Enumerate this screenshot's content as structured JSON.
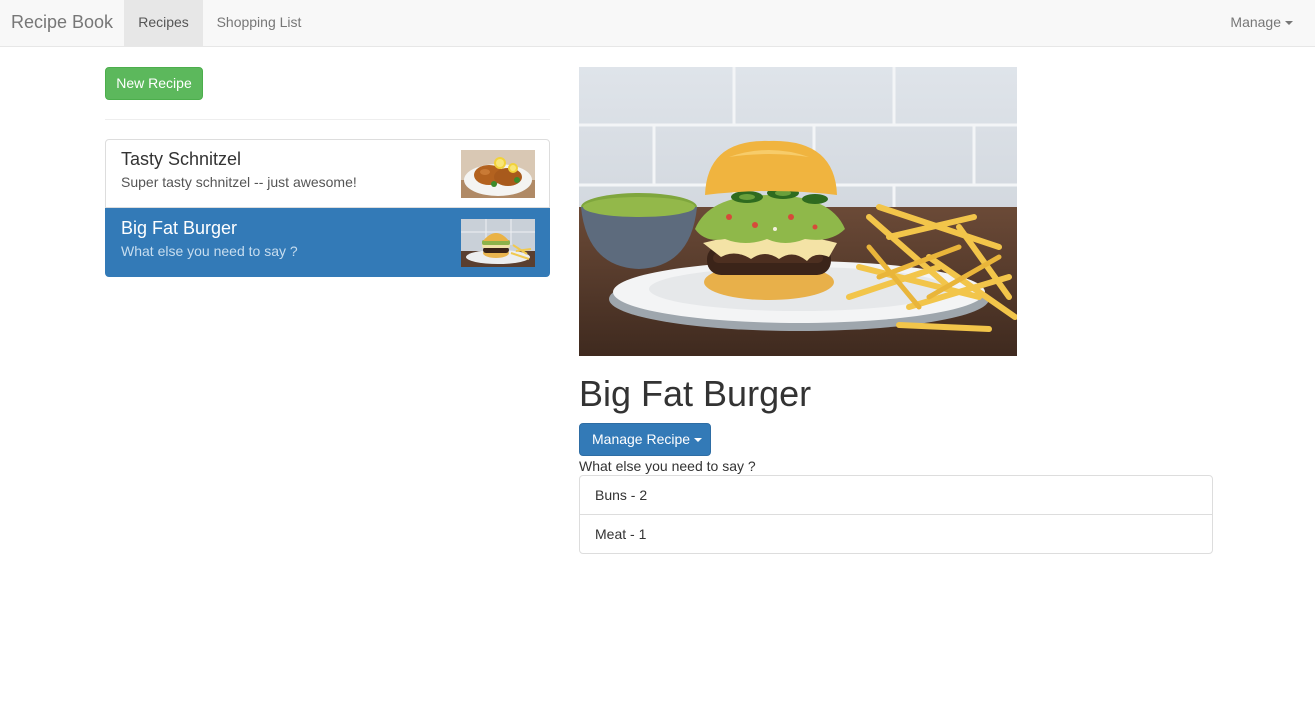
{
  "navbar": {
    "brand": "Recipe Book",
    "tabs": [
      {
        "label": "Recipes",
        "active": true
      },
      {
        "label": "Shopping List",
        "active": false
      }
    ],
    "manage_label": "Manage",
    "manage_icon": "caret-down-icon"
  },
  "sidebar": {
    "new_recipe_label": "New Recipe",
    "recipes": [
      {
        "name": "Tasty Schnitzel",
        "description": "Super tasty schnitzel -- just awesome!",
        "image": "schnitzel-thumbnail",
        "active": false
      },
      {
        "name": "Big Fat Burger",
        "description": "What else you need to say ?",
        "image": "burger-thumbnail",
        "active": true
      }
    ]
  },
  "detail": {
    "image": "burger-photo",
    "title": "Big Fat Burger",
    "manage_button_label": "Manage Recipe",
    "description": "What else you need to say ?",
    "ingredients": [
      {
        "label": "Buns - 2"
      },
      {
        "label": "Meat - 1"
      }
    ]
  },
  "colors": {
    "navbar_bg": "#f8f8f8",
    "primary": "#337ab7",
    "success": "#5cb85c",
    "text": "#333333"
  }
}
